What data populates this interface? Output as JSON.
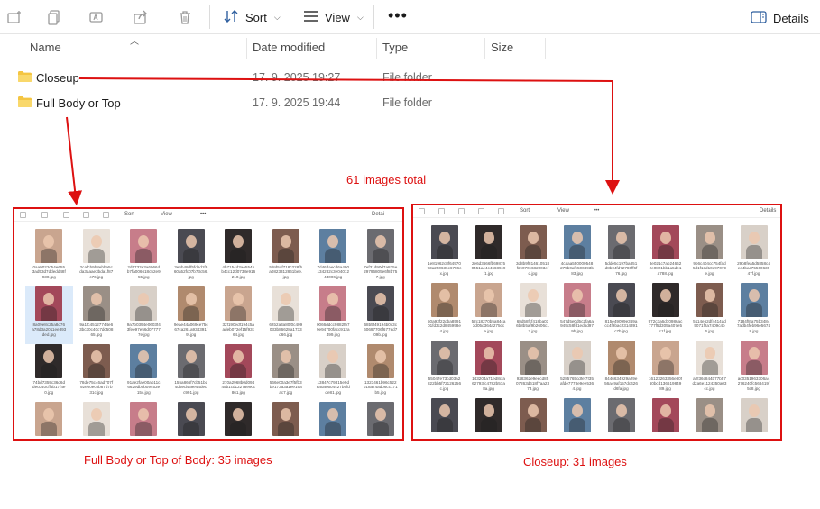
{
  "toolbar": {
    "sort_label": "Sort",
    "view_label": "View",
    "more_label": "•••",
    "details_label": "Details"
  },
  "columns": {
    "name": "Name",
    "date_modified": "Date modified",
    "type": "Type",
    "size": "Size"
  },
  "rows": [
    {
      "name": "Closeup",
      "date": "17. 9. 2025 19:27",
      "type": "File folder"
    },
    {
      "name": "Full Body or Top",
      "date": "17. 9. 2025 19:44",
      "type": "File folder"
    }
  ],
  "annotations": {
    "total": "61 images total",
    "left_caption": "Full Body or Top of Body:  35 images",
    "right_caption": "Closeup:  31 images"
  },
  "mini_left": {
    "sort_label": "Sort",
    "view_label": "View",
    "details_label": "Detai",
    "files": [
      "0aa9022c54e6553ad53d7ddedd48f930.jpg",
      "2cafcb9b8ebba5cda3aaae3bda1f87c76.jpg",
      "2d5733e3a6066db7fa006618c52e955.jpg",
      "3e5b48df5fd5d1f960a52fc07b73c56.jpg",
      "4b7154d3ae554bb4cc12d0738e916210.jpg",
      "5f8d5af718c228fba0823312861bee.jpg",
      "7d46daecd6a490134282c3e0401244006.jpg",
      "7ef31d90d7a835e29796805e6f8b757.jpg",
      "8a09e8c25a8d76a78d3a2011ee393ded.jpg",
      "9a1fc45127744e63bc30c40c7dc50865.jpg",
      "9a7b0394e0603f43fee97e56d077777e.jpg",
      "9eae44a069ce75c67ca261a934391f9f.jpg",
      "32f190edf194c5aadeb072ef15f93c64.jpg",
      "62b2a3a80f0c409033b86628a1733d66.jpg",
      "0066ddcc9882fb79e94700facc912a499.jpg",
      "68b5f49194b0c3c60697706f677ed709b.jpg",
      "74bd7359c36d6ddecd40cff5b17f4e0.jpg",
      "78de75c46ad707f92eb0ec0b87d7b31c.jpg",
      "91ae2fae00ab11c6629db0b09453e15c.jpg",
      "155a866f7cb51bd4d5ed439e44dedc991.jpg",
      "270a2968b0d09445b1cd12278e9cc861.jpg",
      "566e00a3e7f5fb3be173a3a1ee19aac7.jpg",
      "13847c79315e9d8a0a0504427b9fdde81.jpg",
      "1323461b96c522b18a74ad06cc171b5.jpg",
      "",
      "",
      "",
      "",
      "",
      "",
      "",
      ""
    ]
  },
  "mini_right": {
    "sort_label": "Sort",
    "view_label": "View",
    "details_label": "Details",
    "files": [
      "1e81962c8f6497093a250636c6786cx.jpg",
      "2e6d3666fb698750451ae4c46689c9f1.jpg",
      "3d8b9f814610518f2c070c682003efd.jpg",
      "4caaa550000548275b0afc500493b83.jpg",
      "5dde5c197ba851d8b04fd72780ff6f76.jpg",
      "8e021c7ab246622e0821bb1a5de1a788.jpg",
      "9b6c404cc754fad5d1f13d10e97079e.jpg",
      "29b8fea5d5858c4ee4bac7556063947f.jpg",
      "50a93f22dba859101fd3c2d845998e4.jpg",
      "52c18270b5a84ca3d05d364a275cca.jpg",
      "68d58fcf418ba036b8b5af9b2606c17.jpg",
      "547d5e0d5c2fa6a949c58fd1ed5d979b.jpg",
      "815e49099e369acc4f9bac2314391c7b.jpg",
      "972c3a6d70986ac777f5d305a407e5c1f.jpg",
      "5114e52df4414ad5071f2a7409c4b6.jpg",
      "7184f8fa75b34847adb4feb96e56748.jpg",
      "55047e73cd03a2822bb5f72126256c.jpg",
      "143204a71ed8cfa62793fc4782b57a8a.jpg",
      "928362e9eecd8507263d618f7aa2373.jpg",
      "5285765cdfef7f35afde7778e9ee5364.jpg",
      "8446634929a29e56a49af157dc426d6fa.jpg",
      "16123263356e80f60bcd13661984989.jpg",
      "a2f36c844b77b57d2a6e1124350a03cc.jpg",
      "ac0351963306a4276240fc568419f5c8.jpg",
      "",
      "",
      "",
      "",
      "",
      "",
      "",
      ""
    ]
  },
  "icons": {
    "new": "new-folder-icon",
    "copy": "copy-icon",
    "rename": "rename-icon",
    "share": "share-icon",
    "delete": "trash-icon",
    "sort": "sort-icon",
    "view": "view-icon",
    "details": "details-pane-icon",
    "folder": "folder-icon"
  },
  "colors": {
    "annotation_red": "#dd1111",
    "folder_yellow": "#f4c542",
    "selection_blue": "#dbeafa"
  }
}
